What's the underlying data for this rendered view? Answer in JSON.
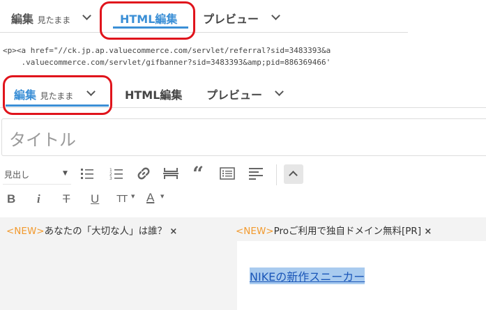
{
  "top_tabs": {
    "edit_label": "編集",
    "edit_sub": "見たまま",
    "html_label": "HTML編集",
    "preview_label": "プレビュー"
  },
  "code_lines": [
    "<p><a href=\"//ck.jp.ap.valuecommerce.com/servlet/referral?sid=3483393&a",
    "    .valuecommerce.com/servlet/gifbanner?sid=3483393&amp;pid=886369466'"
  ],
  "editor_tabs": {
    "edit_label": "編集",
    "edit_sub": "見たまま",
    "html_label": "HTML編集",
    "preview_label": "プレビュー"
  },
  "title_input": {
    "placeholder": "タイトル"
  },
  "toolbar": {
    "heading_select": "見出し",
    "icons": [
      "bullet-list-icon",
      "numbered-list-icon",
      "link-icon",
      "horizontal-rule-icon",
      "quote-icon",
      "table-of-contents-icon",
      "text-align-icon",
      "collapse-toolbar-icon"
    ],
    "format_icons": [
      "bold-icon",
      "italic-icon",
      "strikethrough-icon",
      "underline-icon",
      "font-size-icon",
      "font-color-icon"
    ],
    "bold": "B",
    "italic": "i",
    "strike": "T",
    "underline": "U",
    "fontsize": "TT",
    "fontcolor": "A"
  },
  "notices": [
    {
      "tag": "<NEW>",
      "text": "あなたの「大切な人」は誰？",
      "close": "×"
    },
    {
      "tag": "<NEW>",
      "text": "Proご利用で独自ドメイン無料[PR]",
      "close": "×"
    }
  ],
  "content": {
    "link_text": "NIKEの新作スニーカー"
  },
  "colors": {
    "accent": "#3b8fd6",
    "highlight": "#e0141c",
    "new_tag": "#f29a2e",
    "selection": "#a9cbef"
  }
}
